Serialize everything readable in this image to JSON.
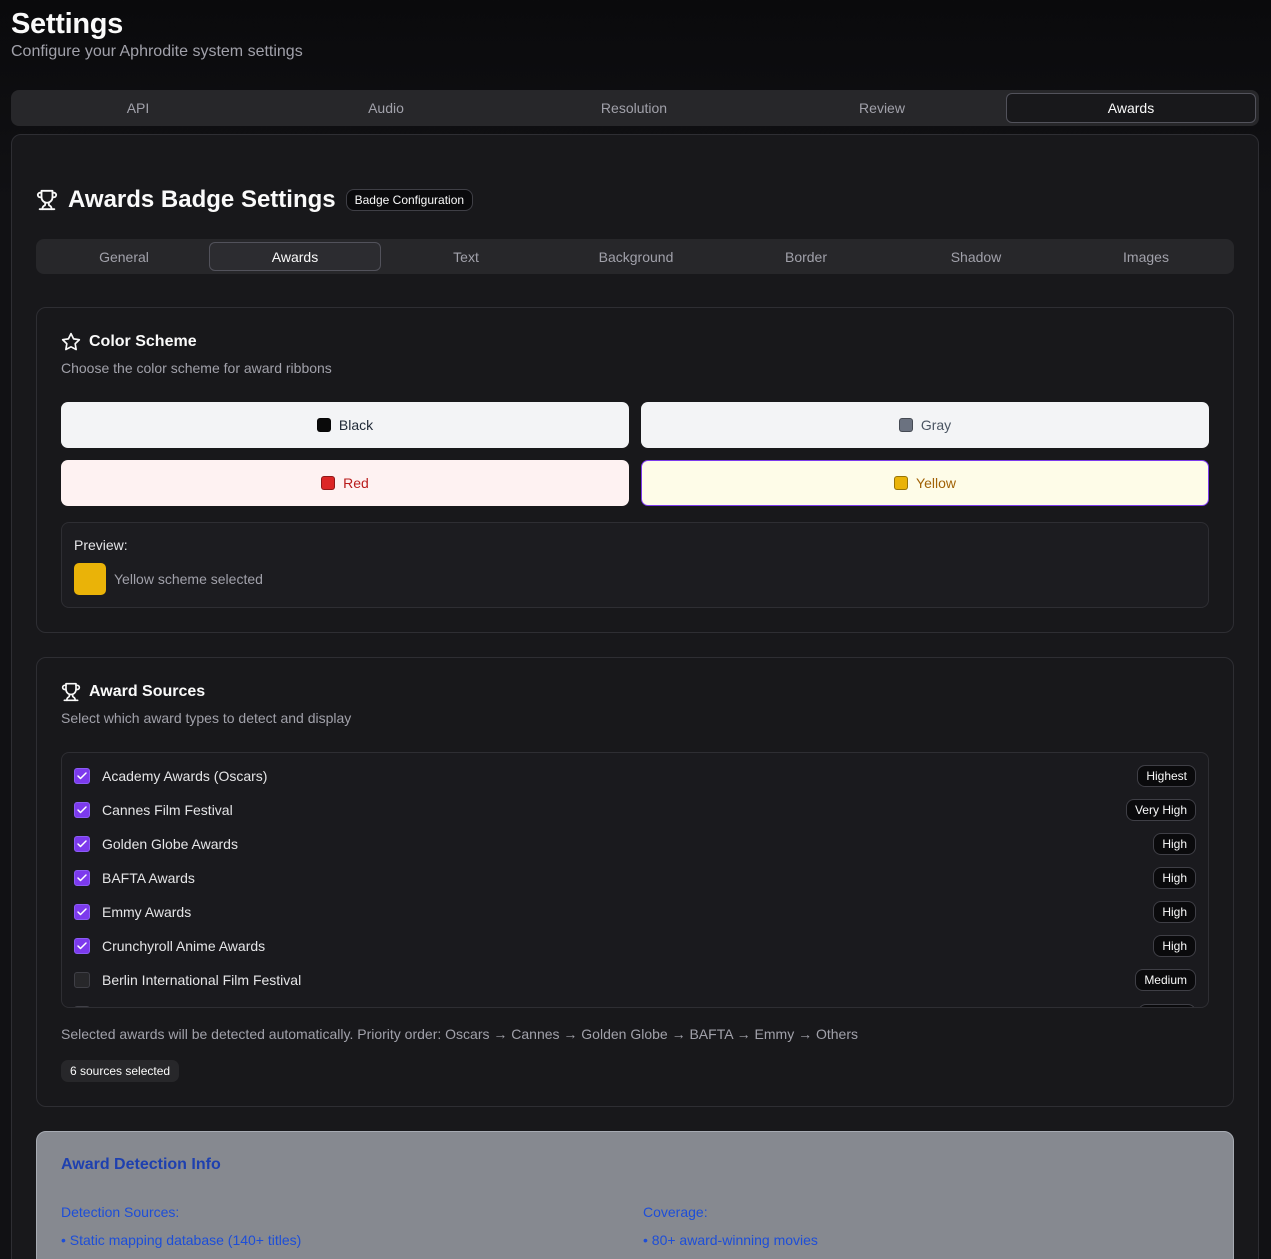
{
  "header": {
    "title": "Settings",
    "subtitle": "Configure your Aphrodite system settings"
  },
  "main_tabs": [
    {
      "label": "API",
      "active": false
    },
    {
      "label": "Audio",
      "active": false
    },
    {
      "label": "Resolution",
      "active": false
    },
    {
      "label": "Review",
      "active": false
    },
    {
      "label": "Awards",
      "active": true
    }
  ],
  "section": {
    "title": "Awards Badge Settings",
    "badge": "Badge Configuration"
  },
  "sub_tabs": [
    {
      "label": "General",
      "active": false
    },
    {
      "label": "Awards",
      "active": true
    },
    {
      "label": "Text",
      "active": false
    },
    {
      "label": "Background",
      "active": false
    },
    {
      "label": "Border",
      "active": false
    },
    {
      "label": "Shadow",
      "active": false
    },
    {
      "label": "Images",
      "active": false
    }
  ],
  "color_scheme": {
    "title": "Color Scheme",
    "description": "Choose the color scheme for award ribbons",
    "options": [
      {
        "label": "Black",
        "swatch": "#0a0a0a",
        "bg": "#f3f4f6",
        "text": "#1f2937",
        "selected": false
      },
      {
        "label": "Gray",
        "swatch": "#6b7280",
        "bg": "#f3f4f6",
        "text": "#4b5563",
        "selected": false
      },
      {
        "label": "Red",
        "swatch": "#dc2626",
        "bg": "#fef2f2",
        "text": "#b91c1c",
        "selected": false
      },
      {
        "label": "Yellow",
        "swatch": "#eab308",
        "bg": "#fefce8",
        "text": "#a16207",
        "selected": true
      }
    ],
    "preview_label": "Preview:",
    "preview_color": "#eab308",
    "preview_text": "Yellow scheme selected"
  },
  "award_sources": {
    "title": "Award Sources",
    "description": "Select which award types to detect and display",
    "items": [
      {
        "label": "Academy Awards (Oscars)",
        "checked": true,
        "priority": "Highest"
      },
      {
        "label": "Cannes Film Festival",
        "checked": true,
        "priority": "Very High"
      },
      {
        "label": "Golden Globe Awards",
        "checked": true,
        "priority": "High"
      },
      {
        "label": "BAFTA Awards",
        "checked": true,
        "priority": "High"
      },
      {
        "label": "Emmy Awards",
        "checked": true,
        "priority": "High"
      },
      {
        "label": "Crunchyroll Anime Awards",
        "checked": true,
        "priority": "High"
      },
      {
        "label": "Berlin International Film Festival",
        "checked": false,
        "priority": "Medium"
      }
    ],
    "note": "Selected awards will be detected automatically. Priority order: Oscars → Cannes → Golden Globe → BAFTA → Emmy → Others",
    "count_label": "6 sources selected"
  },
  "detection_info": {
    "title": "Award Detection Info",
    "sources_heading": "Detection Sources:",
    "sources_item": "• Static mapping database (140+ titles)",
    "coverage_heading": "Coverage:",
    "coverage_item": "• 80+ award-winning movies"
  },
  "icons": {
    "section": "trophy-icon",
    "color_scheme": "star-icon",
    "award_sources": "trophy-icon",
    "checkbox": "check-icon"
  },
  "colors": {
    "accent": "#7c3aed",
    "info_title": "#1e40af",
    "info_text": "#1d4ed8"
  }
}
